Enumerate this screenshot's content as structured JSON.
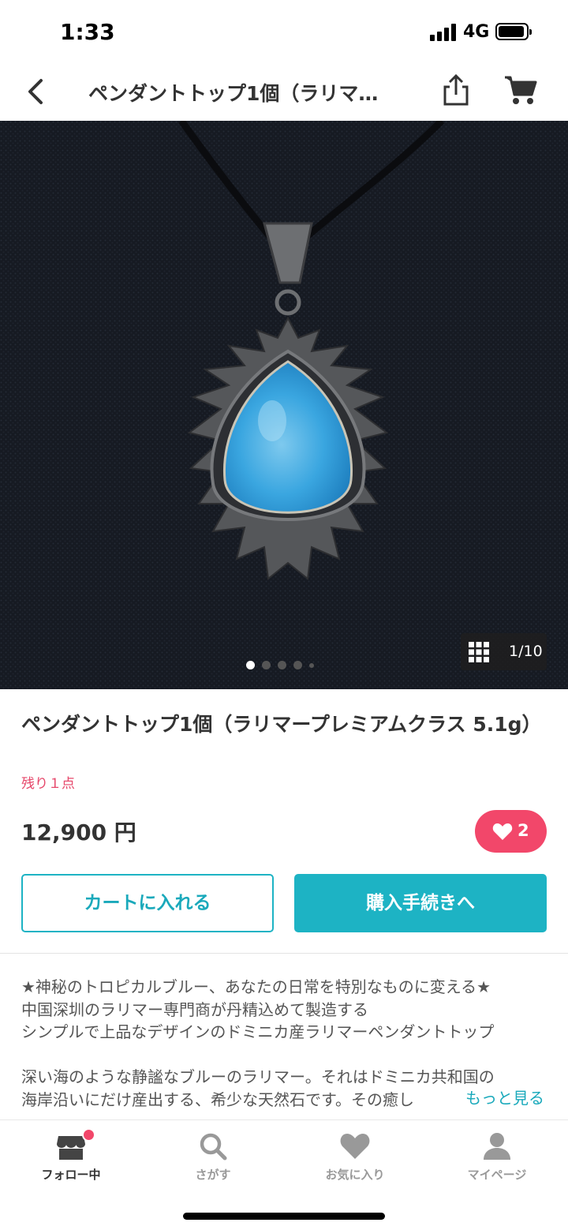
{
  "status_bar": {
    "time": "1:33",
    "network": "4G"
  },
  "nav": {
    "title": "ペンダントトップ1個（ラリマ…",
    "back_icon": "chevron-left-icon",
    "share_icon": "share-icon",
    "cart_icon": "cart-icon"
  },
  "gallery": {
    "counter": "1/10",
    "current_index": 1,
    "dot_count": 5
  },
  "product": {
    "title": "ペンダントトップ1個（ラリマープレミアムクラス 5.1g）",
    "stock": "残り１点",
    "price": "12,900 円",
    "likes": "2"
  },
  "actions": {
    "add_to_cart": "カートに入れる",
    "checkout": "購入手続きへ"
  },
  "description": {
    "lines": [
      "★神秘のトロピカルブルー、あなたの日常を特別なものに変える★",
      "中国深圳のラリマー専門商が丹精込めて製造する",
      "シンプルで上品なデザインのドミニカ産ラリマーペンダントトップ",
      "",
      "深い海のような静謐なブルーのラリマー。それはドミニカ共和国の",
      "海岸沿いにだけ産出する、希少な天然石です。その癒し"
    ],
    "more": "もっと見る"
  },
  "tabs": [
    {
      "label": "フォロー中",
      "icon": "store-icon",
      "active": true,
      "badge": true
    },
    {
      "label": "さがす",
      "icon": "search-icon",
      "active": false
    },
    {
      "label": "お気に入り",
      "icon": "heart-icon",
      "active": false
    },
    {
      "label": "マイページ",
      "icon": "person-icon",
      "active": false
    }
  ],
  "colors": {
    "accent": "#1db3c4",
    "like": "#f2476a",
    "stock": "#e6476a"
  }
}
